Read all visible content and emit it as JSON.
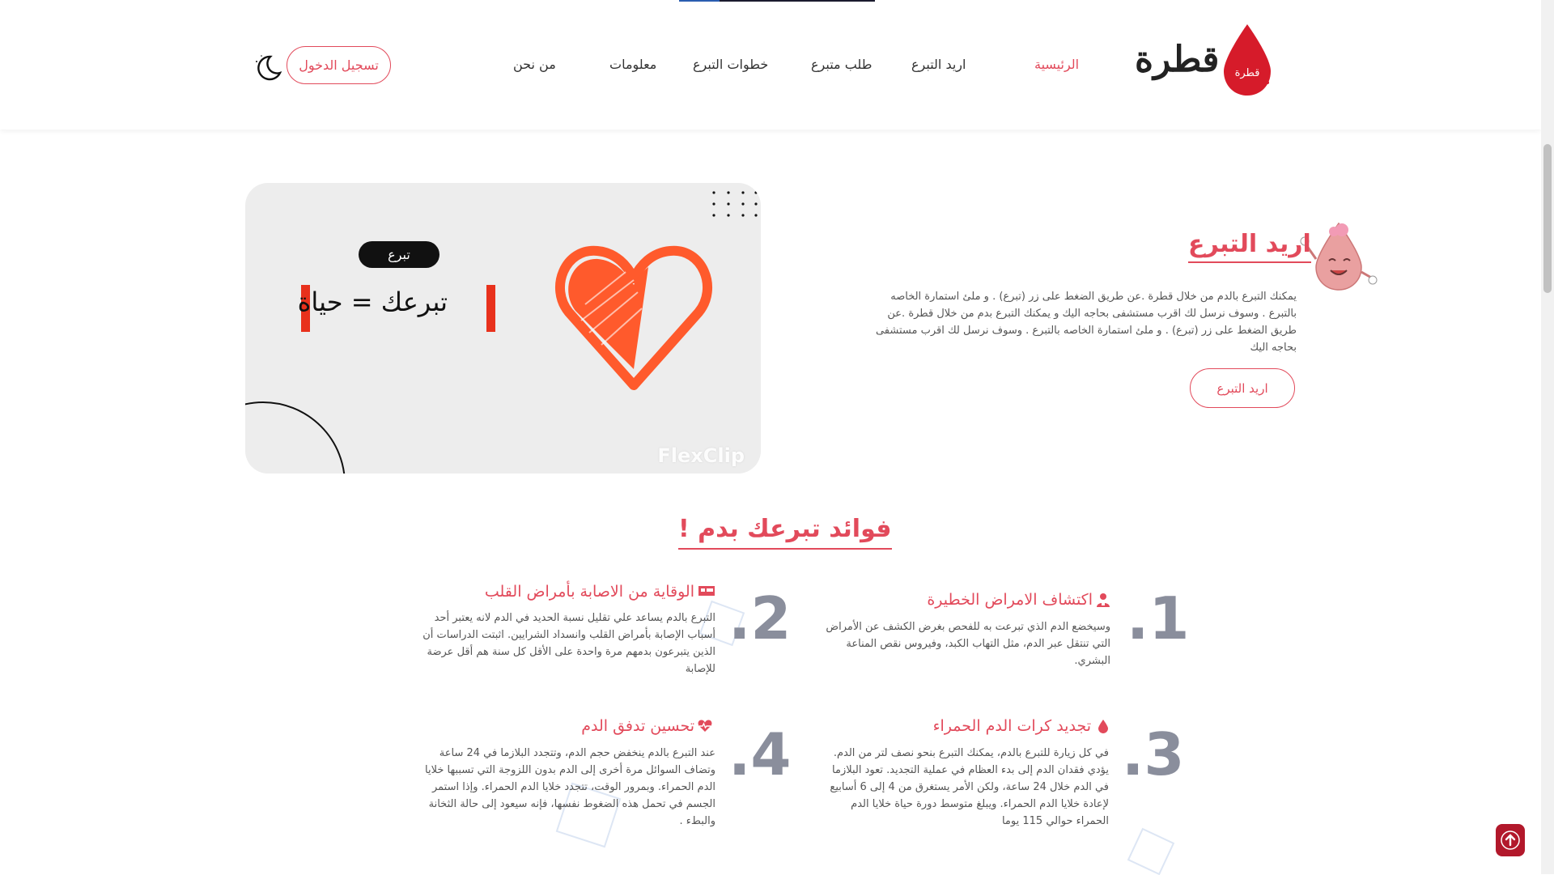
{
  "header": {
    "brand": "قطرة",
    "logo_text": "قطرة",
    "nav": [
      {
        "label": "الرئيسية",
        "active": true
      },
      {
        "label": "اريد التبرع"
      },
      {
        "label": "طلب متبرع"
      },
      {
        "label": "خطوات التبرع"
      },
      {
        "label": "معلومات"
      },
      {
        "label": "من نحن"
      }
    ],
    "login_label": "تسجيل الدخول",
    "theme_icon": "moon-icon"
  },
  "hero": {
    "video": {
      "tag": "تبرع",
      "slogan": "تبرعك = حياة",
      "watermark": "FlexClip"
    },
    "title": "اريد التبرع",
    "text": "يمكنك التبرع بالدم من خلال قطرة .عن طريق الضغط على زر (تبرع) . و ملئ استمارة الخاصه بالتبرع . وسوف نرسل لك اقرب مستشفى بحاجه اليك و يمكنك التبرع بدم من خلال قطرة .عن طريق الضغط على زر (تبرع) . و ملئ استمارة الخاصه بالتبرع . وسوف نرسل لك اقرب مستشفى بحاجه اليك",
    "button": "اريد التبرع"
  },
  "benefits": {
    "title": "فوائد تبرعك بدم !",
    "items": [
      {
        "num": ".1",
        "title": "اكتشاف الامراض الخطيرة",
        "icon": "user-doctor-icon",
        "text": "وسيخضع الدم الذي تبرعت به للفحص بغرض الكشف عن الأمراض التي تنتقل عبر الدم، مثل التهاب الكبد، وفيروس نقص المناعة البشري."
      },
      {
        "num": ".2",
        "title": "الوقاية من الاصابة بأمراض القلب",
        "icon": "hospital-bed-icon",
        "text": "التبرع بالدم يساعد علي تقليل نسبة الحديد في الدم لانه يعتبر أحد أسباب الإصابة بأمراض القلب وانسداد الشرايين. اثبتت الدراسات أن الذين يتبرعون بدمهم مرة واحدة على الأقل كل سنة هم أقل عرضة للإصابة"
      },
      {
        "num": ".3",
        "title": "تجديد كرات الدم الحمراء",
        "icon": "blood-drop-icon",
        "text": "في كل زيارة للتبرع بالدم، يمكنك التبرع بنحو نصف لتر من الدم. يؤدي فقدان الدم إلى بدء العظام في عملية التجديد. تعود البلازما في الدم خلال 24 ساعة، ولكن الأمر يستغرق من 4 إلى 6 أسابيع لإعادة خلايا الدم الحمراء. ويبلغ متوسط دورة حياة خلايا الدم الحمراء حوالي 115 يوما"
      },
      {
        "num": ".4",
        "title": "تحسين تدفق الدم",
        "icon": "heartbeat-icon",
        "text": "عند التبرع بالدم ينخفض حجم الدم، وتتجدد البلازما في 24 ساعة وتضاف السوائل مرة أخرى إلى الدم بدون اللزوجة التي تسببها خلايا الدم الحمراء. وبمرور الوقت، تتجدد خلايا الدم الحمراء. وإذا استمر الجسم في تحمل هذه الضغوط نفسها، فإنه سيعود إلى حالة الثخانة والبطء ."
      }
    ]
  },
  "colors": {
    "accent": "#e24a5b",
    "number": "#8a8e9c",
    "heart": "#ff5a2c"
  }
}
